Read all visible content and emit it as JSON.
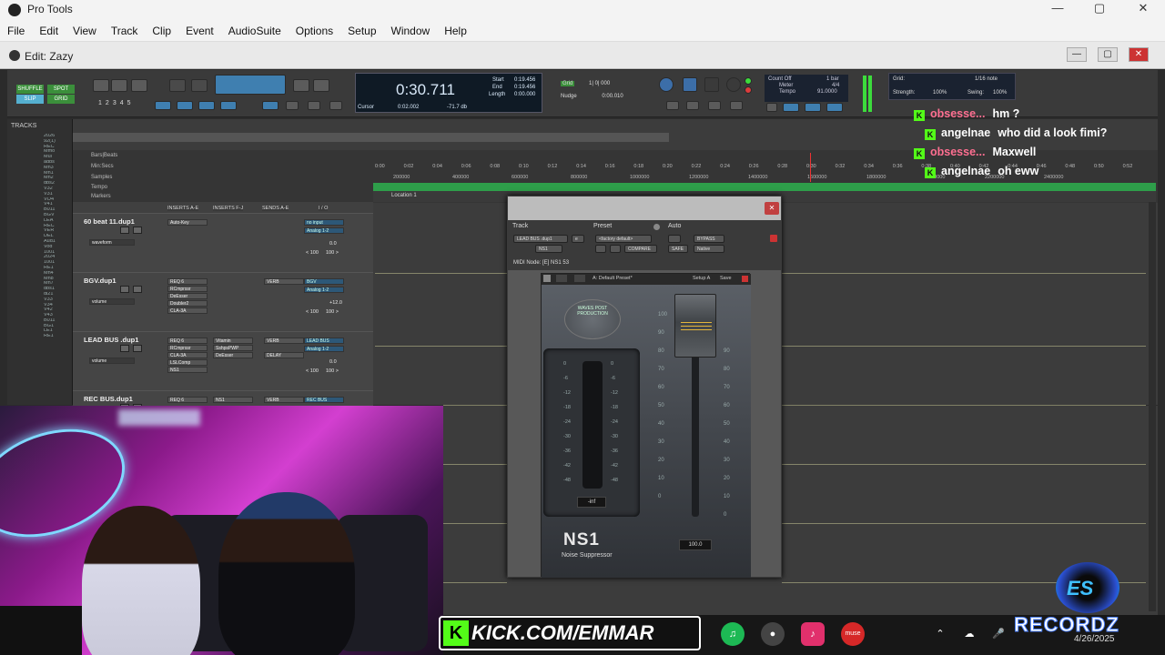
{
  "window": {
    "app_title": "Pro Tools",
    "edit_title": "Edit: Zazy"
  },
  "menu": [
    "File",
    "Edit",
    "View",
    "Track",
    "Clip",
    "Event",
    "AudioSuite",
    "Options",
    "Setup",
    "Window",
    "Help"
  ],
  "modes": {
    "shuffle": "SHUFFLE",
    "spot": "SPOT",
    "slip": "SLIP",
    "grid": "GRID"
  },
  "toolbar_numbers": [
    "1",
    "2",
    "3",
    "4",
    "5"
  ],
  "counter": {
    "main": "0:30.711",
    "start_label": "Start",
    "start": "0:19.456",
    "end_label": "End",
    "end": "0:19.456",
    "length_label": "Length",
    "length": "0:00.000",
    "cursor_label": "Cursor",
    "cursor": "0:02.002",
    "db": "-71.7 db",
    "grid_label": "Grid",
    "grid_value": "1| 0| 000",
    "nudge_label": "Nudge",
    "nudge_value": "0:00.010"
  },
  "transport_info": {
    "count_off": "Count Off",
    "meter_label": "Meter",
    "tempo_label": "Tempo",
    "bar": "1 bar",
    "meter": "4/4",
    "tempo": "91.0000"
  },
  "grid_settings": {
    "grid": "Grid:",
    "note": "1/16 note",
    "strength_label": "Strength:",
    "strength": "100%",
    "swing_label": "Swing:",
    "swing": "100%"
  },
  "tracks_panel": {
    "title": "TRACKS",
    "names": [
      "2026",
      "92(1)",
      "REC",
      "Mmo",
      "Mul",
      "adbs",
      "Mn3",
      "Mn1",
      "Mn2",
      "dbs2",
      "V32",
      "V31",
      "VO4",
      "V41",
      "B011",
      "BGV",
      "LEA",
      "REC",
      "VER",
      "DEL",
      "Aud1",
      "Vod",
      "1001",
      "2024",
      "1001",
      "RE1",
      "Mn4",
      "Mn8",
      "Mn7",
      "dbs1",
      "dl21",
      "V33",
      "V34",
      "V42",
      "V43",
      "B011",
      "BG1",
      "LE1",
      "RE1"
    ]
  },
  "rulers": {
    "labels": [
      "Bars|Beats",
      "Min:Secs",
      "Samples",
      "Tempo",
      "Markers"
    ],
    "min_secs": [
      "0:00",
      "0:02",
      "0:04",
      "0:06",
      "0:08",
      "0:10",
      "0:12",
      "0:14",
      "0:16",
      "0:18",
      "0:20",
      "0:22",
      "0:24",
      "0:26",
      "0:28",
      "0:30",
      "0:32",
      "0:34",
      "0:36",
      "0:38",
      "0:40",
      "0:42",
      "0:44",
      "0:46",
      "0:48",
      "0:50",
      "0:52"
    ],
    "samples": [
      "200000",
      "400000",
      "600000",
      "800000",
      "1000000",
      "1200000",
      "1400000",
      "1600000",
      "1800000",
      "2000000",
      "2200000",
      "2400000"
    ],
    "marker": "Location 1"
  },
  "mixer_columns": [
    "INSERTS A-E",
    "INSERTS F-J",
    "SENDS A-E",
    "I / O"
  ],
  "strips": [
    {
      "name": "60 beat 11.dup1",
      "ins_a": [
        "Auto-Key"
      ],
      "ins_f": [],
      "sends": [],
      "io": [
        "no input",
        "Analog 1-2"
      ],
      "vol": "0.0",
      "pan": [
        "< 100",
        "100 >"
      ],
      "view": "waveform"
    },
    {
      "name": "BGV.dup1",
      "ins_a": [
        "REQ 6",
        "RCmprssr",
        "DeEsser",
        "Doubler2",
        "CLA-3A"
      ],
      "ins_f": [],
      "sends": [
        "VERB"
      ],
      "io": [
        "BGV",
        "Analog 1-2"
      ],
      "vol": "+12.0",
      "pan": [
        "< 100",
        "100 >"
      ],
      "view": "volume"
    },
    {
      "name": "LEAD BUS .dup1",
      "ins_a": [
        "REQ 6",
        "RCmprssr",
        "CLA-3A",
        "LSLComp",
        "NS1"
      ],
      "ins_f": [
        "Vitamin",
        "SshpsPWP",
        "DeEsser"
      ],
      "sends": [
        "VERB",
        "DELAY"
      ],
      "io": [
        "LEAD BUS",
        "Analog 1-2"
      ],
      "vol": "0.0",
      "pan": [
        "< 100",
        "100 >"
      ],
      "view": "volume"
    },
    {
      "name": "REC BUS.dup1",
      "ins_a": [
        "REQ 6"
      ],
      "ins_f": [
        "NS1"
      ],
      "sends": [
        "VERB"
      ],
      "io": [
        "REC BUS"
      ],
      "vol": "",
      "pan": [],
      "view": ""
    }
  ],
  "plugin": {
    "track_label": "Track",
    "preset_label": "Preset",
    "auto_label": "Auto",
    "track_name": "LEAD BUS .dup1",
    "track_mode": "e",
    "preset": "<factory default>",
    "insert": "NS1",
    "compare": "COMPARE",
    "bypass": "BYPASS",
    "safe": "SAFE",
    "native": "Native",
    "midi_node": "MIDI Node: [E] NS1 53",
    "waves_toolbar": [
      "A: Default Preset*",
      "Setup A",
      "Save"
    ],
    "badge": "WAVES POST PRODUCTION",
    "meter_ticks": [
      "0",
      "-6",
      "-12",
      "-18",
      "-24",
      "-30",
      "-36",
      "-42",
      "-48"
    ],
    "meter_value": "-inf",
    "fader_ticks_left": [
      "100",
      "90",
      "80",
      "70",
      "60",
      "50",
      "40",
      "30",
      "20",
      "10",
      "0"
    ],
    "fader_ticks_right": [
      "90",
      "80",
      "70",
      "60",
      "50",
      "40",
      "30",
      "20",
      "10",
      "0"
    ],
    "fader_value": "100.0",
    "fader_level": 1.0,
    "logo": "NS1",
    "subtitle": "Noise Suppressor"
  },
  "chat": [
    {
      "user": "obsesse...",
      "msg": "hm ?",
      "user_color": "#ff6f91"
    },
    {
      "user": "angelnae",
      "msg": "who did a look fimi?",
      "user_color": "#fdfdfd"
    },
    {
      "user": "obsesse...",
      "msg": "Maxwell",
      "user_color": "#ff6f91"
    },
    {
      "user": "angelnae",
      "msg": "oh eww",
      "user_color": "#fdfdfd"
    }
  ],
  "overlay": {
    "kick": "KICK.COM/EMMAR",
    "brand": "RECORDZ",
    "brand_top": "ES",
    "date": "4/26/2025",
    "music_app": "muse"
  },
  "colors": {
    "kick_green": "#53fc18",
    "timeline_green": "#2e9e4a",
    "plugin_close": "#c14040"
  }
}
